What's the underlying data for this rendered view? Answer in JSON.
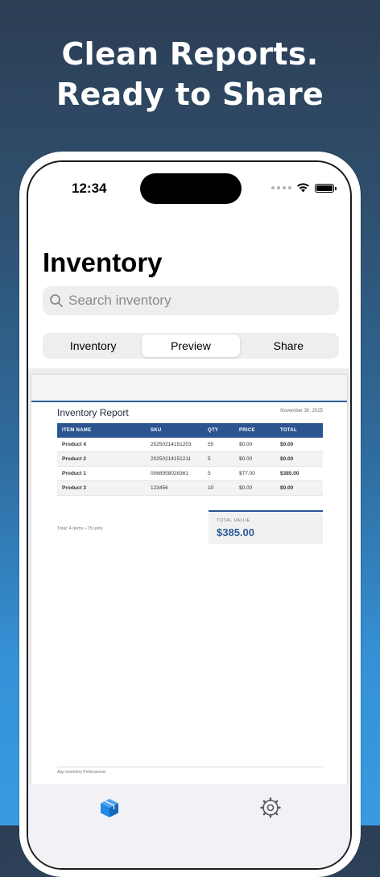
{
  "headline": {
    "line1": "Clean Reports.",
    "line2": "Ready to Share"
  },
  "status": {
    "time": "12:34"
  },
  "app": {
    "title": "Inventory"
  },
  "search": {
    "placeholder": "Search inventory"
  },
  "segments": [
    {
      "label": "Inventory",
      "active": false
    },
    {
      "label": "Preview",
      "active": true
    },
    {
      "label": "Share",
      "active": false
    }
  ],
  "report": {
    "title": "Inventory Report",
    "date": "November 30, 2025",
    "columns": [
      "ITEM NAME",
      "SKU",
      "QTY",
      "PRICE",
      "TOTAL"
    ],
    "rows": [
      {
        "name": "Product 4",
        "sku": "20250214151203",
        "qty": "55",
        "price": "$0.00",
        "total": "$0.00"
      },
      {
        "name": "Product 2",
        "sku": "20250214151211",
        "qty": "5",
        "price": "$0.00",
        "total": "$0.00"
      },
      {
        "name": "Product 1",
        "sku": "0068958028361",
        "qty": "5",
        "price": "$77.00",
        "total": "$385.00"
      },
      {
        "name": "Product 3",
        "sku": "123456",
        "qty": "10",
        "price": "$0.00",
        "total": "$0.00"
      }
    ],
    "summary": "Total: 4 items • 75 units",
    "total_label": "TOTAL VALUE",
    "total_value": "$385.00",
    "footer": "App Inventory Professional"
  },
  "tabbar": {
    "items": [
      {
        "icon": "box-icon",
        "active": true,
        "color": "#1e88e5"
      },
      {
        "icon": "gear-icon",
        "active": false,
        "color": "#5c5c60"
      }
    ]
  },
  "colors": {
    "accent": "#2b5490",
    "brand_blue": "#1e88e5"
  }
}
